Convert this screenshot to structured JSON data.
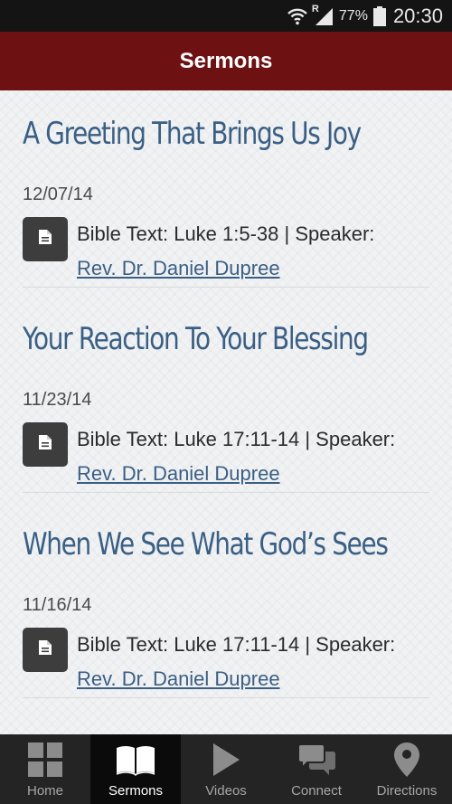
{
  "status_bar": {
    "network_type": "R",
    "battery": "77%",
    "time": "20:30"
  },
  "header": {
    "title": "Sermons",
    "color": "#6e1113"
  },
  "sermons": [
    {
      "title": "A Greeting That Brings Us Joy",
      "date": "12/07/14",
      "details": "Bible Text: Luke 1:5-38 | Speaker:",
      "speaker": "Rev. Dr. Daniel Dupree",
      "icon": "document-icon"
    },
    {
      "title": "Your Reaction To Your Blessing",
      "date": "11/23/14",
      "details": "Bible Text: Luke 17:11-14 | Speaker:",
      "speaker": "Rev. Dr. Daniel Dupree",
      "icon": "document-icon"
    },
    {
      "title": "When We See What God’s Sees",
      "date": "11/16/14",
      "details": "Bible Text: Luke 17:11-14 | Speaker:",
      "speaker": "Rev. Dr. Daniel Dupree",
      "icon": "document-icon"
    }
  ],
  "bottom_nav": {
    "active": "Sermons",
    "items": [
      {
        "label": "Home",
        "icon": "grid-icon"
      },
      {
        "label": "Sermons",
        "icon": "book-icon"
      },
      {
        "label": "Videos",
        "icon": "play-icon"
      },
      {
        "label": "Connect",
        "icon": "chat-icon"
      },
      {
        "label": "Directions",
        "icon": "map-pin-icon"
      }
    ]
  },
  "colors": {
    "title_blue": "#3a5f84",
    "nav_background": "#242424",
    "status_bar": "#141414"
  }
}
